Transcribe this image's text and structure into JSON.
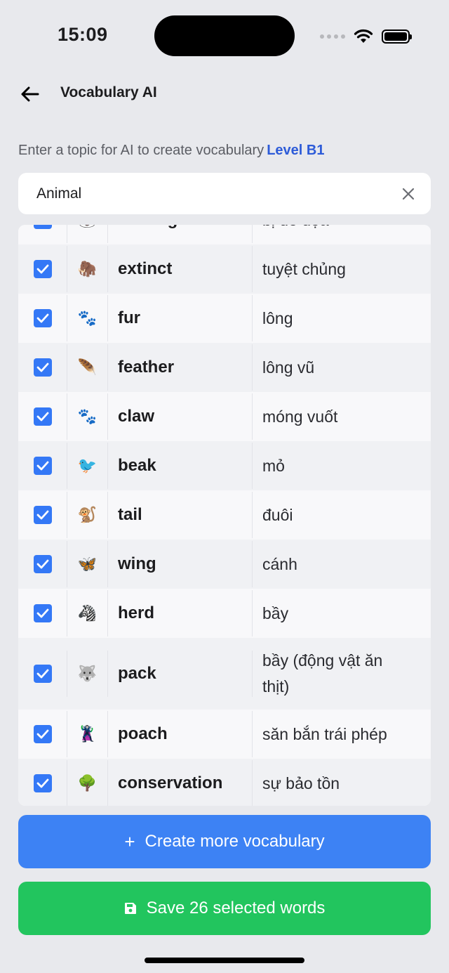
{
  "status_bar": {
    "time": "15:09"
  },
  "header": {
    "title": "Vocabulary AI"
  },
  "prompt": {
    "text": "Enter a topic for AI to create vocabulary",
    "level": "Level B1"
  },
  "topic_input": {
    "value": "Animal",
    "placeholder": ""
  },
  "rows": [
    {
      "emoji": "🐼",
      "word": "endangered",
      "meaning": "bị đe dọa",
      "checked": true
    },
    {
      "emoji": "🦣",
      "word": "extinct",
      "meaning": "tuyệt chủng",
      "checked": true
    },
    {
      "emoji": "🐾",
      "word": "fur",
      "meaning": "lông",
      "checked": true
    },
    {
      "emoji": "🪶",
      "word": "feather",
      "meaning": "lông vũ",
      "checked": true
    },
    {
      "emoji": "🐾",
      "word": "claw",
      "meaning": "móng vuốt",
      "checked": true
    },
    {
      "emoji": "🐦",
      "word": "beak",
      "meaning": "mỏ",
      "checked": true
    },
    {
      "emoji": "🐒",
      "word": "tail",
      "meaning": "đuôi",
      "checked": true
    },
    {
      "emoji": "🦋",
      "word": "wing",
      "meaning": "cánh",
      "checked": true
    },
    {
      "emoji": "🦓",
      "word": "herd",
      "meaning": "bầy",
      "checked": true
    },
    {
      "emoji": "🐺",
      "word": "pack",
      "meaning": "bầy (động vật ăn thịt)",
      "checked": true
    },
    {
      "emoji": "🦹",
      "word": "poach",
      "meaning": "săn bắn trái phép",
      "checked": true
    },
    {
      "emoji": "🌳",
      "word": "conservation",
      "meaning": "sự bảo tồn",
      "checked": true
    }
  ],
  "buttons": {
    "create_more": "Create more vocabulary",
    "save": "Save 26 selected words"
  },
  "colors": {
    "accent_blue": "#3d82f4",
    "save_green": "#22c55e",
    "level_blue": "#2d5bd8"
  }
}
